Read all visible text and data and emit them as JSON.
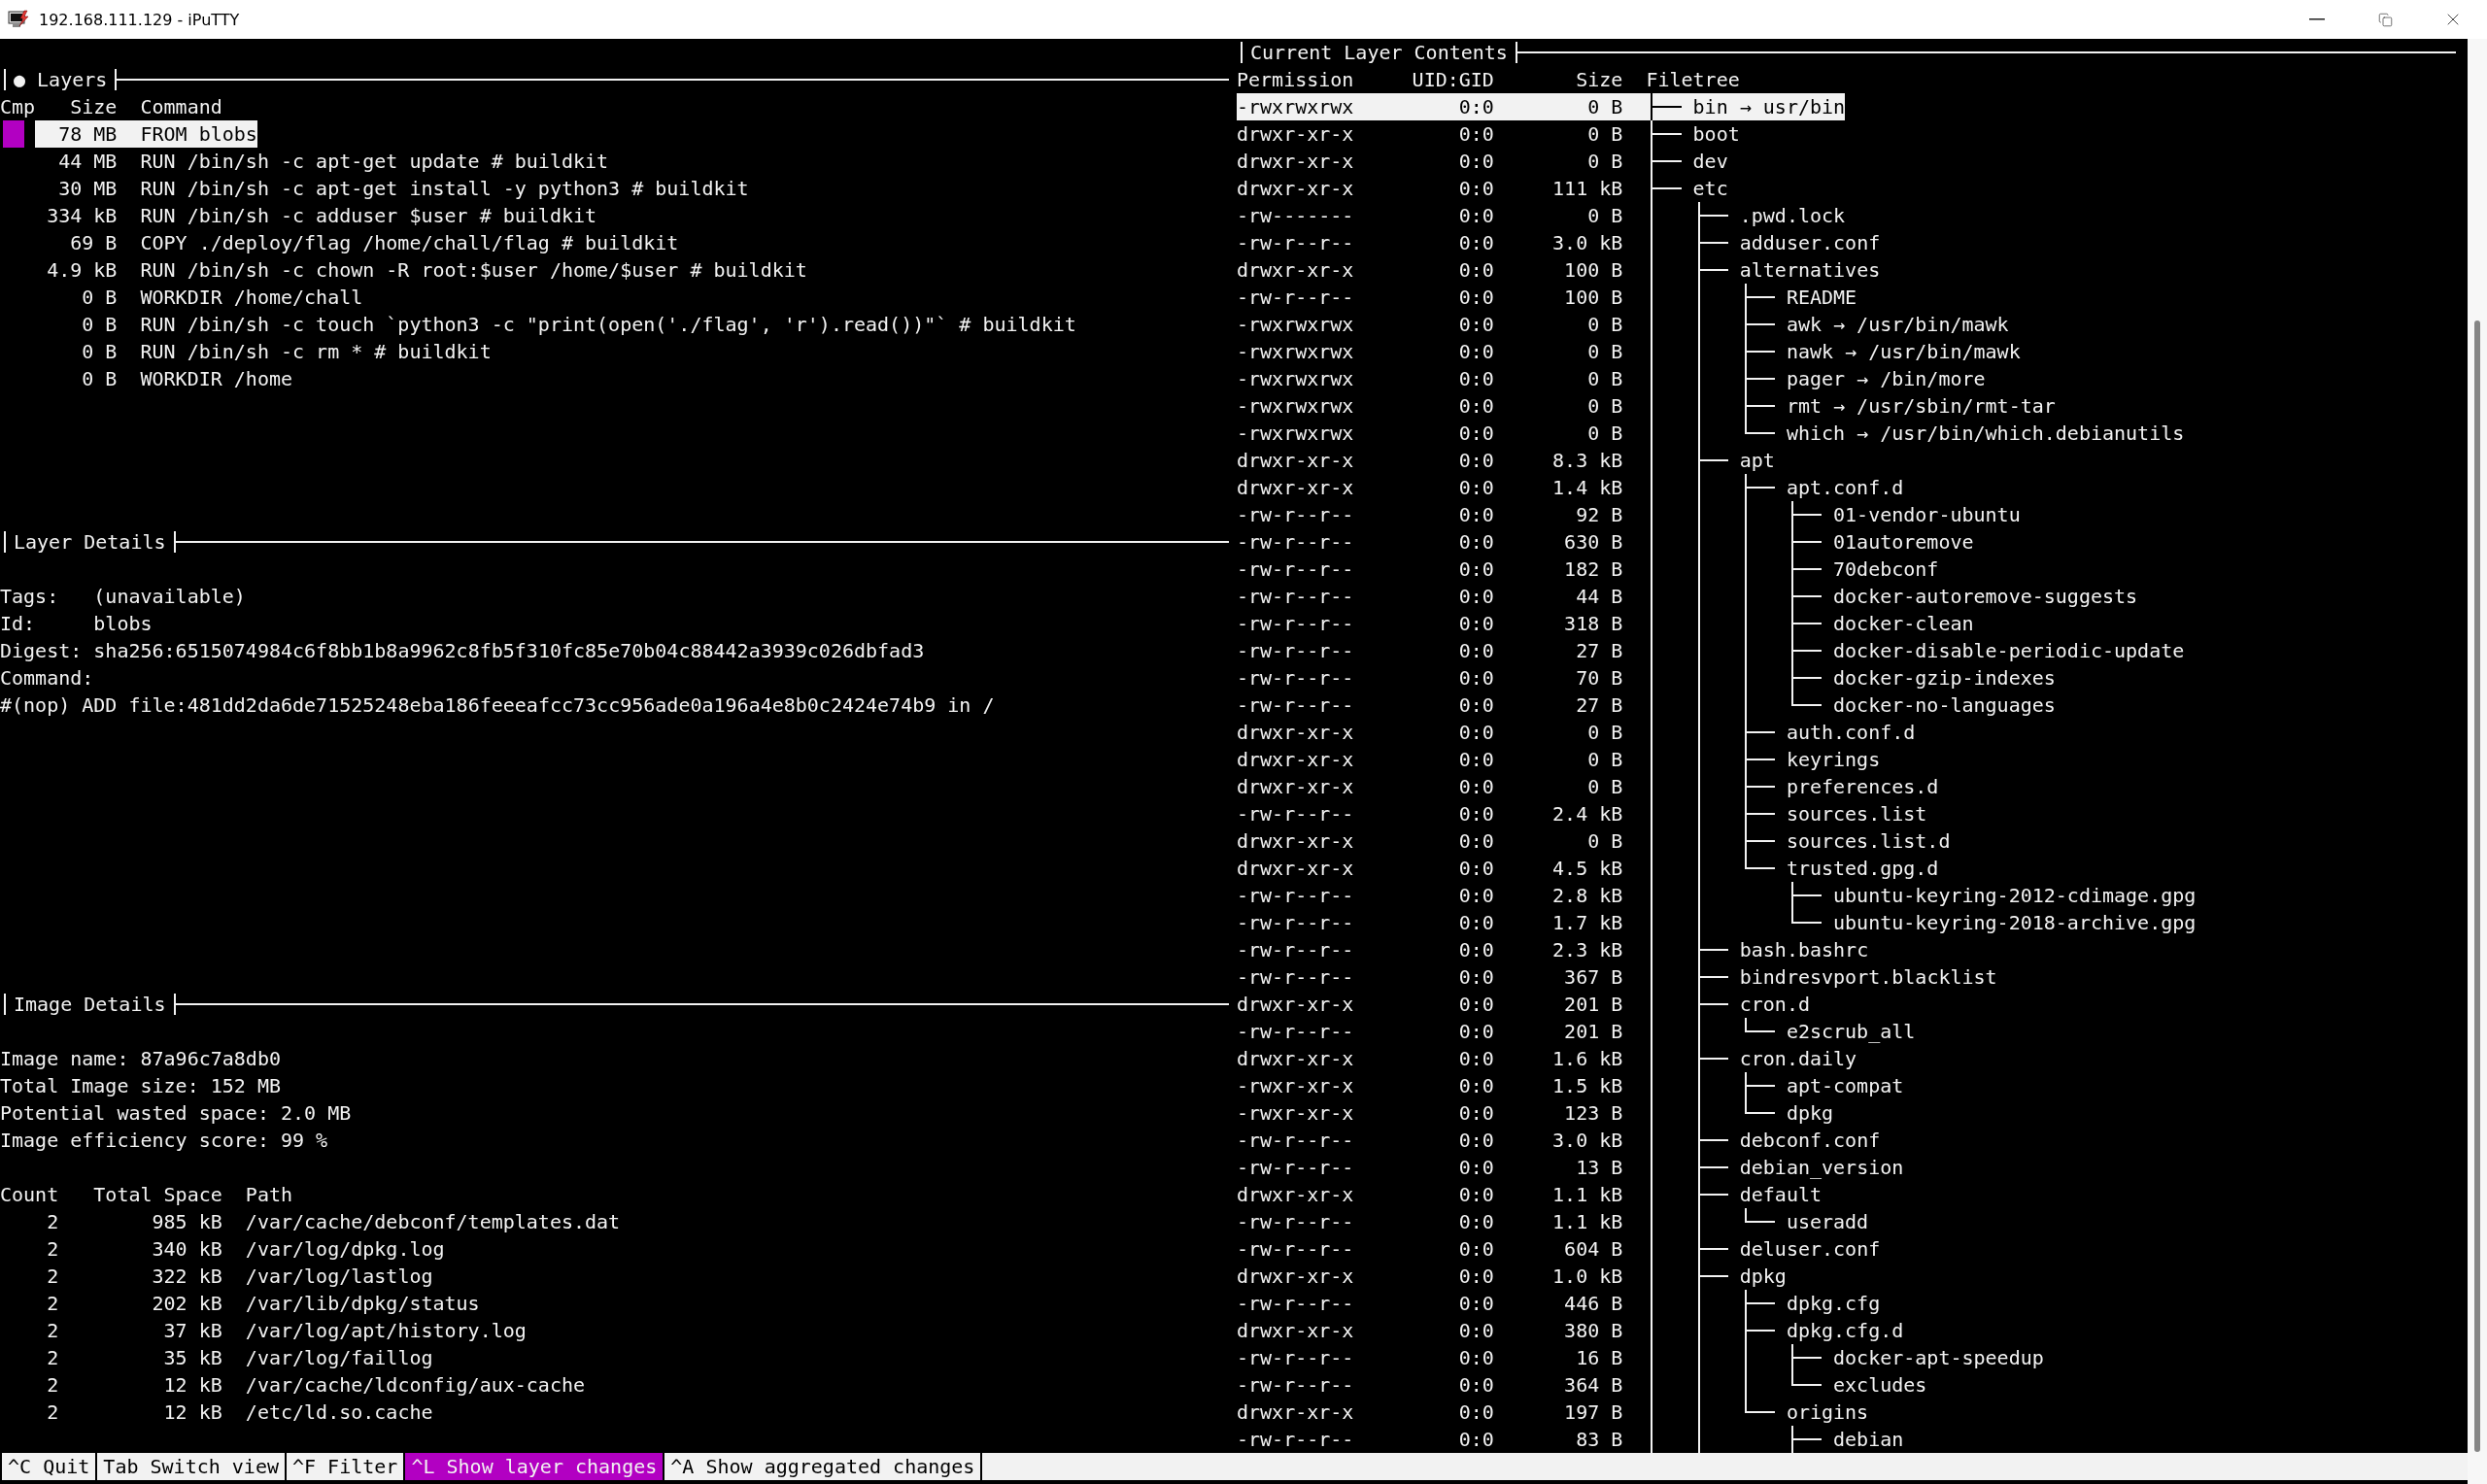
{
  "window": {
    "title": "192.168.111.129 - iPuTTY"
  },
  "layers": {
    "title": "● Layers",
    "columns": [
      "Cmp",
      "Size",
      "Command"
    ],
    "rows": [
      {
        "size": "78 MB",
        "command": "FROM blobs",
        "selected": true,
        "compared": true
      },
      {
        "size": "44 MB",
        "command": "RUN /bin/sh -c apt-get update # buildkit",
        "selected": false,
        "compared": false
      },
      {
        "size": "30 MB",
        "command": "RUN /bin/sh -c apt-get install -y python3 # buildkit",
        "selected": false,
        "compared": false
      },
      {
        "size": "334 kB",
        "command": "RUN /bin/sh -c adduser $user # buildkit",
        "selected": false,
        "compared": false
      },
      {
        "size": "69 B",
        "command": "COPY ./deploy/flag /home/chall/flag # buildkit",
        "selected": false,
        "compared": false
      },
      {
        "size": "4.9 kB",
        "command": "RUN /bin/sh -c chown -R root:$user /home/$user # buildkit",
        "selected": false,
        "compared": false
      },
      {
        "size": "0 B",
        "command": "WORKDIR /home/chall",
        "selected": false,
        "compared": false
      },
      {
        "size": "0 B",
        "command": "RUN /bin/sh -c touch `python3 -c \"print(open('./flag', 'r').read())\"` # buildkit",
        "selected": false,
        "compared": false
      },
      {
        "size": "0 B",
        "command": "RUN /bin/sh -c rm * # buildkit",
        "selected": false,
        "compared": false
      },
      {
        "size": "0 B",
        "command": "WORKDIR /home",
        "selected": false,
        "compared": false
      }
    ]
  },
  "layer_details": {
    "title": "Layer Details",
    "fields": [
      {
        "label": "Tags:",
        "value": "(unavailable)"
      },
      {
        "label": "Id:",
        "value": "blobs"
      },
      {
        "label": "Digest:",
        "value": "sha256:6515074984c6f8bb1b8a9962c8fb5f310fc85e70b04c88442a3939c026dbfad3"
      }
    ],
    "command_label": "Command:",
    "command": "#(nop) ADD file:481dd2da6de71525248eba186feeeafcc73cc956ade0a196a4e8b0c2424e74b9 in /"
  },
  "image_details": {
    "title": "Image Details",
    "lines": [
      "Image name: 87a96c7a8db0",
      "Total Image size: 152 MB",
      "Potential wasted space: 2.0 MB",
      "Image efficiency score: 99 %"
    ],
    "columns": [
      "Count",
      "Total Space",
      "Path"
    ],
    "rows": [
      {
        "count": "2",
        "total_space": "985 kB",
        "path": "/var/cache/debconf/templates.dat"
      },
      {
        "count": "2",
        "total_space": "340 kB",
        "path": "/var/log/dpkg.log"
      },
      {
        "count": "2",
        "total_space": "322 kB",
        "path": "/var/log/lastlog"
      },
      {
        "count": "2",
        "total_space": "202 kB",
        "path": "/var/lib/dpkg/status"
      },
      {
        "count": "2",
        "total_space": "37 kB",
        "path": "/var/log/apt/history.log"
      },
      {
        "count": "2",
        "total_space": "35 kB",
        "path": "/var/log/faillog"
      },
      {
        "count": "2",
        "total_space": "12 kB",
        "path": "/var/cache/ldconfig/aux-cache"
      },
      {
        "count": "2",
        "total_space": "12 kB",
        "path": "/etc/ld.so.cache"
      }
    ]
  },
  "layer_contents": {
    "title": "Current Layer Contents",
    "columns": [
      "Permission",
      "UID:GID",
      "Size",
      "Filetree"
    ],
    "continues": true,
    "tree": [
      {
        "permission": "-rwxrwxrwx",
        "uid_gid": "0:0",
        "size": "0 B",
        "name": "bin → usr/bin",
        "selected": true
      },
      {
        "permission": "drwxr-xr-x",
        "uid_gid": "0:0",
        "size": "0 B",
        "name": "boot",
        "selected": false
      },
      {
        "permission": "drwxr-xr-x",
        "uid_gid": "0:0",
        "size": "0 B",
        "name": "dev",
        "selected": false
      },
      {
        "permission": "drwxr-xr-x",
        "uid_gid": "0:0",
        "size": "111 kB",
        "name": "etc",
        "selected": false,
        "continues": true,
        "children": [
          {
            "permission": "-rw-------",
            "uid_gid": "0:0",
            "size": "0 B",
            "name": ".pwd.lock",
            "selected": false
          },
          {
            "permission": "-rw-r--r--",
            "uid_gid": "0:0",
            "size": "3.0 kB",
            "name": "adduser.conf",
            "selected": false
          },
          {
            "permission": "drwxr-xr-x",
            "uid_gid": "0:0",
            "size": "100 B",
            "name": "alternatives",
            "selected": false,
            "children": [
              {
                "permission": "-rw-r--r--",
                "uid_gid": "0:0",
                "size": "100 B",
                "name": "README",
                "selected": false
              },
              {
                "permission": "-rwxrwxrwx",
                "uid_gid": "0:0",
                "size": "0 B",
                "name": "awk → /usr/bin/mawk",
                "selected": false
              },
              {
                "permission": "-rwxrwxrwx",
                "uid_gid": "0:0",
                "size": "0 B",
                "name": "nawk → /usr/bin/mawk",
                "selected": false
              },
              {
                "permission": "-rwxrwxrwx",
                "uid_gid": "0:0",
                "size": "0 B",
                "name": "pager → /bin/more",
                "selected": false
              },
              {
                "permission": "-rwxrwxrwx",
                "uid_gid": "0:0",
                "size": "0 B",
                "name": "rmt → /usr/sbin/rmt-tar",
                "selected": false
              },
              {
                "permission": "-rwxrwxrwx",
                "uid_gid": "0:0",
                "size": "0 B",
                "name": "which → /usr/bin/which.debianutils",
                "selected": false
              }
            ]
          },
          {
            "permission": "drwxr-xr-x",
            "uid_gid": "0:0",
            "size": "8.3 kB",
            "name": "apt",
            "selected": false,
            "children": [
              {
                "permission": "drwxr-xr-x",
                "uid_gid": "0:0",
                "size": "1.4 kB",
                "name": "apt.conf.d",
                "selected": false,
                "children": [
                  {
                    "permission": "-rw-r--r--",
                    "uid_gid": "0:0",
                    "size": "92 B",
                    "name": "01-vendor-ubuntu",
                    "selected": false
                  },
                  {
                    "permission": "-rw-r--r--",
                    "uid_gid": "0:0",
                    "size": "630 B",
                    "name": "01autoremove",
                    "selected": false
                  },
                  {
                    "permission": "-rw-r--r--",
                    "uid_gid": "0:0",
                    "size": "182 B",
                    "name": "70debconf",
                    "selected": false
                  },
                  {
                    "permission": "-rw-r--r--",
                    "uid_gid": "0:0",
                    "size": "44 B",
                    "name": "docker-autoremove-suggests",
                    "selected": false
                  },
                  {
                    "permission": "-rw-r--r--",
                    "uid_gid": "0:0",
                    "size": "318 B",
                    "name": "docker-clean",
                    "selected": false
                  },
                  {
                    "permission": "-rw-r--r--",
                    "uid_gid": "0:0",
                    "size": "27 B",
                    "name": "docker-disable-periodic-update",
                    "selected": false
                  },
                  {
                    "permission": "-rw-r--r--",
                    "uid_gid": "0:0",
                    "size": "70 B",
                    "name": "docker-gzip-indexes",
                    "selected": false
                  },
                  {
                    "permission": "-rw-r--r--",
                    "uid_gid": "0:0",
                    "size": "27 B",
                    "name": "docker-no-languages",
                    "selected": false
                  }
                ]
              },
              {
                "permission": "drwxr-xr-x",
                "uid_gid": "0:0",
                "size": "0 B",
                "name": "auth.conf.d",
                "selected": false
              },
              {
                "permission": "drwxr-xr-x",
                "uid_gid": "0:0",
                "size": "0 B",
                "name": "keyrings",
                "selected": false
              },
              {
                "permission": "drwxr-xr-x",
                "uid_gid": "0:0",
                "size": "0 B",
                "name": "preferences.d",
                "selected": false
              },
              {
                "permission": "-rw-r--r--",
                "uid_gid": "0:0",
                "size": "2.4 kB",
                "name": "sources.list",
                "selected": false
              },
              {
                "permission": "drwxr-xr-x",
                "uid_gid": "0:0",
                "size": "0 B",
                "name": "sources.list.d",
                "selected": false
              },
              {
                "permission": "drwxr-xr-x",
                "uid_gid": "0:0",
                "size": "4.5 kB",
                "name": "trusted.gpg.d",
                "selected": false,
                "children": [
                  {
                    "permission": "-rw-r--r--",
                    "uid_gid": "0:0",
                    "size": "2.8 kB",
                    "name": "ubuntu-keyring-2012-cdimage.gpg",
                    "selected": false
                  },
                  {
                    "permission": "-rw-r--r--",
                    "uid_gid": "0:0",
                    "size": "1.7 kB",
                    "name": "ubuntu-keyring-2018-archive.gpg",
                    "selected": false
                  }
                ]
              }
            ]
          },
          {
            "permission": "-rw-r--r--",
            "uid_gid": "0:0",
            "size": "2.3 kB",
            "name": "bash.bashrc",
            "selected": false
          },
          {
            "permission": "-rw-r--r--",
            "uid_gid": "0:0",
            "size": "367 B",
            "name": "bindresvport.blacklist",
            "selected": false
          },
          {
            "permission": "drwxr-xr-x",
            "uid_gid": "0:0",
            "size": "201 B",
            "name": "cron.d",
            "selected": false,
            "children": [
              {
                "permission": "-rw-r--r--",
                "uid_gid": "0:0",
                "size": "201 B",
                "name": "e2scrub_all",
                "selected": false
              }
            ]
          },
          {
            "permission": "drwxr-xr-x",
            "uid_gid": "0:0",
            "size": "1.6 kB",
            "name": "cron.daily",
            "selected": false,
            "children": [
              {
                "permission": "-rwxr-xr-x",
                "uid_gid": "0:0",
                "size": "1.5 kB",
                "name": "apt-compat",
                "selected": false
              },
              {
                "permission": "-rwxr-xr-x",
                "uid_gid": "0:0",
                "size": "123 B",
                "name": "dpkg",
                "selected": false
              }
            ]
          },
          {
            "permission": "-rw-r--r--",
            "uid_gid": "0:0",
            "size": "3.0 kB",
            "name": "debconf.conf",
            "selected": false
          },
          {
            "permission": "-rw-r--r--",
            "uid_gid": "0:0",
            "size": "13 B",
            "name": "debian_version",
            "selected": false
          },
          {
            "permission": "drwxr-xr-x",
            "uid_gid": "0:0",
            "size": "1.1 kB",
            "name": "default",
            "selected": false,
            "children": [
              {
                "permission": "-rw-r--r--",
                "uid_gid": "0:0",
                "size": "1.1 kB",
                "name": "useradd",
                "selected": false
              }
            ]
          },
          {
            "permission": "-rw-r--r--",
            "uid_gid": "0:0",
            "size": "604 B",
            "name": "deluser.conf",
            "selected": false
          },
          {
            "permission": "drwxr-xr-x",
            "uid_gid": "0:0",
            "size": "1.0 kB",
            "name": "dpkg",
            "selected": false,
            "children": [
              {
                "permission": "-rw-r--r--",
                "uid_gid": "0:0",
                "size": "446 B",
                "name": "dpkg.cfg",
                "selected": false
              },
              {
                "permission": "drwxr-xr-x",
                "uid_gid": "0:0",
                "size": "380 B",
                "name": "dpkg.cfg.d",
                "selected": false,
                "children": [
                  {
                    "permission": "-rw-r--r--",
                    "uid_gid": "0:0",
                    "size": "16 B",
                    "name": "docker-apt-speedup",
                    "selected": false
                  },
                  {
                    "permission": "-rw-r--r--",
                    "uid_gid": "0:0",
                    "size": "364 B",
                    "name": "excludes",
                    "selected": false
                  }
                ]
              },
              {
                "permission": "drwxr-xr-x",
                "uid_gid": "0:0",
                "size": "197 B",
                "name": "origins",
                "selected": false,
                "continues": true,
                "children": [
                  {
                    "permission": "-rw-r--r--",
                    "uid_gid": "0:0",
                    "size": "83 B",
                    "name": "debian",
                    "selected": false
                  }
                ]
              }
            ]
          }
        ]
      }
    ]
  },
  "status_bar": [
    {
      "text": "^C Quit",
      "selected": false
    },
    {
      "text": "Tab Switch view",
      "selected": false
    },
    {
      "text": "^F Filter",
      "selected": false
    },
    {
      "text": "^L Show layer changes",
      "selected": true
    },
    {
      "text": "^A Show aggregated changes",
      "selected": false
    }
  ]
}
